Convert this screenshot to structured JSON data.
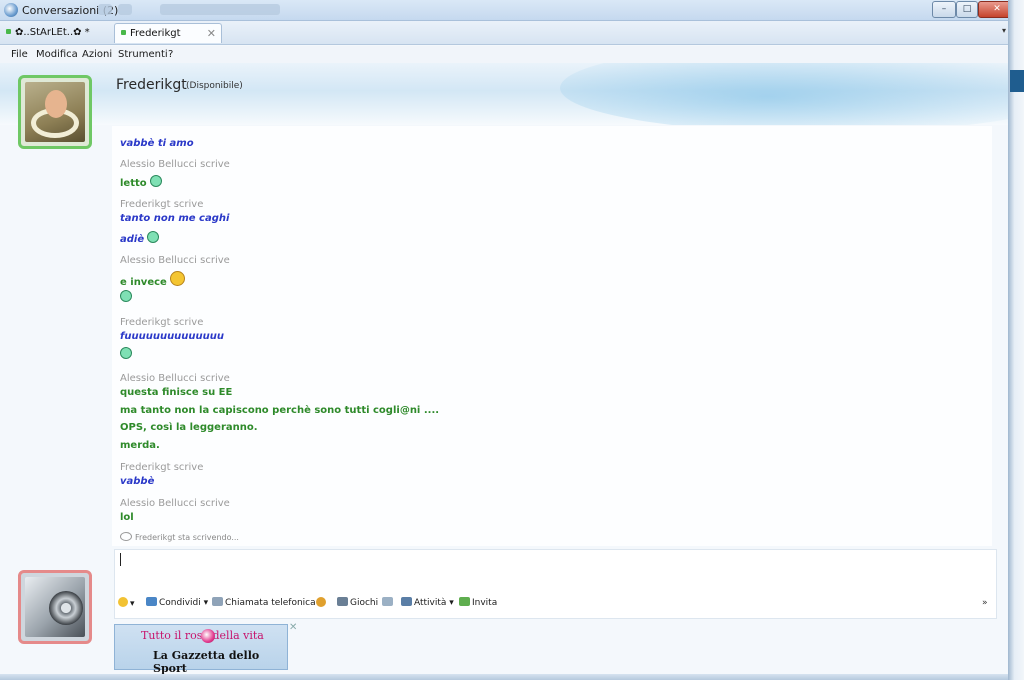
{
  "window": {
    "title": "Conversazioni (2)",
    "controls": {
      "minimize": "–",
      "maximize": "□",
      "close": "✕"
    }
  },
  "tabs": [
    {
      "label": "✿..StArLEt..✿ *",
      "active": false
    },
    {
      "label": "Frederikgt",
      "active": true,
      "close": "✕"
    }
  ],
  "tab_menu_glyph": "▾",
  "menu": [
    "File",
    "Modifica",
    "Azioni",
    "Strumenti",
    "?"
  ],
  "contact": {
    "name": "Frederikgt",
    "status": "(Disponibile)"
  },
  "conversation": {
    "lines": [
      {
        "kind": "msg",
        "who": "fred",
        "text": "vabbè ti amo"
      },
      {
        "kind": "sender",
        "text": "Alessio Bellucci scrive"
      },
      {
        "kind": "msg",
        "who": "alessio",
        "text": "letto",
        "emoticon": "green-smiley"
      },
      {
        "kind": "sender",
        "text": "Frederikgt scrive"
      },
      {
        "kind": "msg",
        "who": "fred",
        "text": "tanto non me caghi"
      },
      {
        "kind": "msg",
        "who": "fred",
        "text": "adiè",
        "emoticon": "green-smiley"
      },
      {
        "kind": "sender",
        "text": "Alessio Bellucci scrive"
      },
      {
        "kind": "msg",
        "who": "alessio",
        "text": "e invece",
        "emoticon": "grin-smiley"
      },
      {
        "kind": "emoticon-only",
        "emoticon": "green-smiley"
      },
      {
        "kind": "sender",
        "text": "Frederikgt scrive"
      },
      {
        "kind": "msg",
        "who": "fred",
        "text": "fuuuuuuuuuuuuuu"
      },
      {
        "kind": "emoticon-only",
        "emoticon": "green-smiley"
      },
      {
        "kind": "sender",
        "text": "Alessio Bellucci scrive"
      },
      {
        "kind": "msg",
        "who": "alessio",
        "text": "questa finisce su EE"
      },
      {
        "kind": "msg",
        "who": "alessio",
        "text": "ma tanto non la capiscono perchè sono tutti cogli@ni ...."
      },
      {
        "kind": "msg",
        "who": "alessio",
        "text": "OPS, così la leggeranno."
      },
      {
        "kind": "msg",
        "who": "alessio",
        "text": "merda."
      },
      {
        "kind": "sender",
        "text": "Frederikgt scrive"
      },
      {
        "kind": "msg",
        "who": "fred",
        "text": "vabbè"
      },
      {
        "kind": "sender",
        "text": "Alessio Bellucci scrive"
      },
      {
        "kind": "msg",
        "who": "alessio",
        "text": "lol"
      }
    ],
    "typing": "Frederikgt sta scrivendo..."
  },
  "toolbar": {
    "share": "Condividi",
    "call": "Chiamata telefonica",
    "games": "Giochi",
    "activities": "Attività",
    "invite": "Invita",
    "more": "»"
  },
  "ad": {
    "line1": "Tutto il rosa della vita",
    "line2": "La Gazzetta dello Sport",
    "close": "✕"
  },
  "colors": {
    "friend_text": "#2a38c8",
    "self_text": "#2e8a2a",
    "sender_label": "#9a9a9a"
  }
}
